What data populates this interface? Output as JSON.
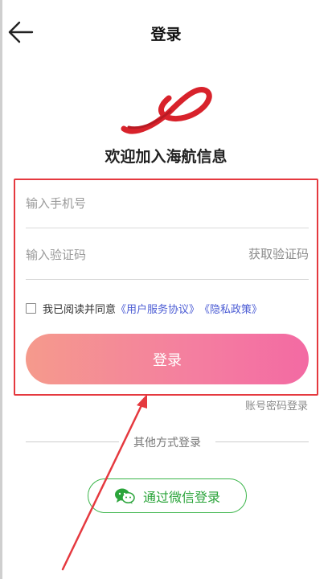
{
  "header": {
    "title": "登录"
  },
  "brand": {
    "welcome_text": "欢迎加入海航信息"
  },
  "form": {
    "phone_placeholder": "输入手机号",
    "code_placeholder": "输入验证码",
    "get_code_label": "获取验证码",
    "agree_prefix": "我已阅读并同意",
    "user_agreement": "《用户服务协议》",
    "privacy_policy": "《隐私政策》",
    "login_label": "登录"
  },
  "alt": {
    "account_login_label": "账号密码登录",
    "other_methods_label": "其他方式登录",
    "wechat_login_label": "通过微信登录"
  },
  "colors": {
    "accent_red": "#e5393f",
    "button_gradient_start": "#f59a8c",
    "button_gradient_end": "#f36aa3",
    "wechat_green": "#3bb54a",
    "link_blue": "#4a5bd4"
  }
}
